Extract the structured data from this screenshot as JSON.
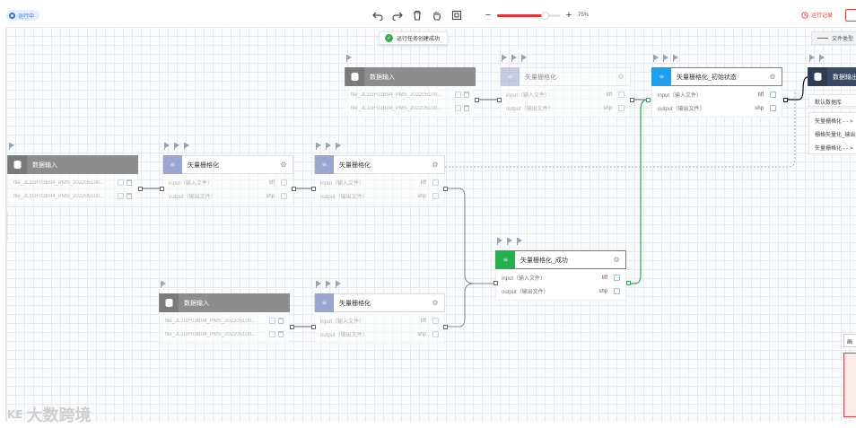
{
  "topbar": {
    "status": "运行中",
    "zoom_pct": "75%",
    "zoom_level": 0.75,
    "run_log": "运行记录",
    "accent": "#e63232"
  },
  "toast": {
    "message": "运行任务创建成功",
    "icon": "check-circle-icon",
    "color": "#33b249"
  },
  "legend": {
    "label": "文件类型"
  },
  "labels": {
    "data_input": "数据输入",
    "vector_raster": "矢量栅格化",
    "vector_raster_init": "矢量栅格化_初始状态",
    "vector_raster_success": "矢量栅格化_成功",
    "data_output": "数据输出",
    "input_file": "input（输入文件）",
    "output_file": "output（输出文件）",
    "tiff": "tiff",
    "shp": "shp",
    "file1": "file_JL1GF03B04_PMS_202205100...",
    "file2": "file_JL1GF03B04_PMS_202205100..."
  },
  "output_panel": {
    "default_db": "默认数据库",
    "items": [
      "矢量栅格化 - - >",
      "栅格矢量化_输出",
      "矢量栅格化 - - >"
    ]
  },
  "minimap": {
    "label": "画"
  },
  "watermark": {
    "text": "大数跨境",
    "logo": "KE"
  },
  "colors": {
    "running": "#2f6fe8",
    "success": "#22b14c",
    "init": "#1e9ef0",
    "disabled_node": "#8d8d8d",
    "output_node": "#3a4a63"
  }
}
